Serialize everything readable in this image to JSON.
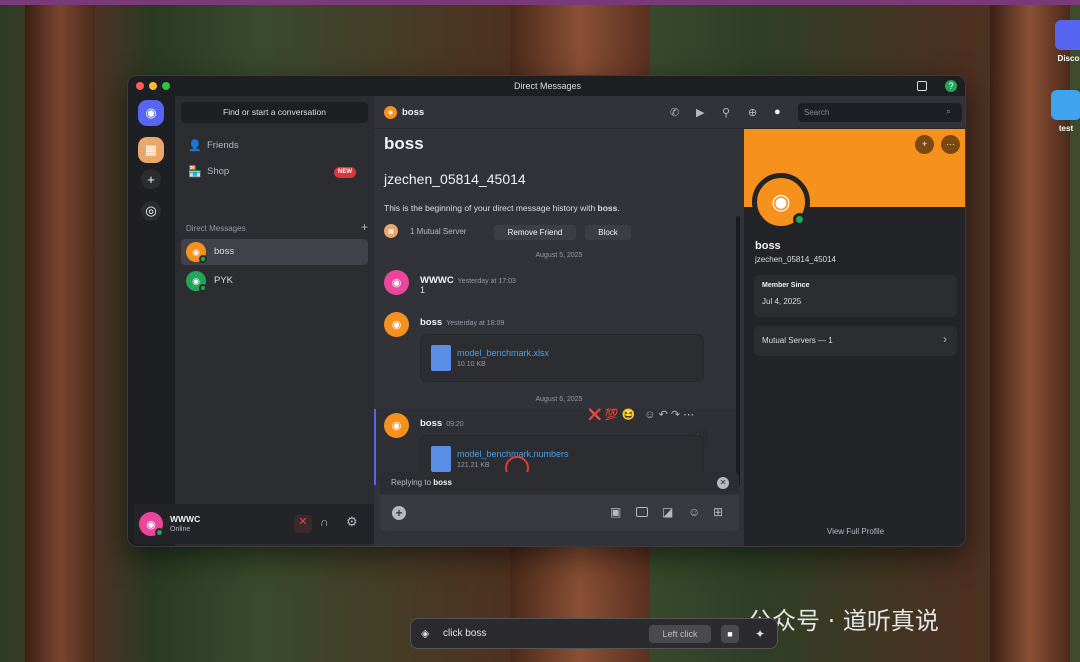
{
  "window": {
    "title": "Direct Messages"
  },
  "colors": {
    "accent": "#5865f2",
    "brand_orange": "#f6911e",
    "online": "#23a55a",
    "new_badge": "#da373c",
    "link": "#4e9de6"
  },
  "desktop": {
    "icons": [
      {
        "label": "Discor"
      },
      {
        "label": "test"
      }
    ],
    "watermark": "公众号 · 道听真说"
  },
  "sidebar": {
    "find_placeholder": "Find or start a conversation",
    "nav": [
      {
        "label": "Friends",
        "icon": "friends-icon"
      },
      {
        "label": "Shop",
        "icon": "shop-icon",
        "badge": "NEW"
      }
    ],
    "dm_header": "Direct Messages",
    "dms": [
      {
        "name": "boss",
        "active": true
      },
      {
        "name": "PYK",
        "active": false
      }
    ]
  },
  "user_panel": {
    "name": "WWWC",
    "status": "Online"
  },
  "chat": {
    "header_name": "boss",
    "search_placeholder": "Search",
    "intro_title": "boss",
    "intro_username": "jzechen_05814_45014",
    "intro_text": "This is the beginning of your direct message history with ",
    "intro_bold": "boss",
    "intro_end": ".",
    "mutual_server": "1 Mutual Server",
    "remove_friend": "Remove Friend",
    "block": "Block",
    "date1": "August 5, 2025",
    "date2": "August 6, 2025",
    "messages": [
      {
        "author": "WWWC",
        "time": "Yesterday at 17:03",
        "text": "1"
      },
      {
        "author": "boss",
        "time": "Yesterday at 18:09",
        "file": "model_benchmark.xlsx",
        "size": "10.10 KB"
      },
      {
        "author": "boss",
        "time": "09:20",
        "file": "model_benchmark.numbers",
        "size": "121.21 KB"
      }
    ],
    "reactions": [
      "❌",
      "💯",
      "😆"
    ],
    "reply_prefix": "Replying to ",
    "reply_target": "boss"
  },
  "profile": {
    "name": "boss",
    "username": "jzechen_05814_45014",
    "member_since_label": "Member Since",
    "member_since": "Jul 4, 2025",
    "mutual_servers": "Mutual Servers — 1",
    "view_full": "View Full Profile"
  },
  "taskbar": {
    "text": "click boss",
    "button": "Left click"
  }
}
